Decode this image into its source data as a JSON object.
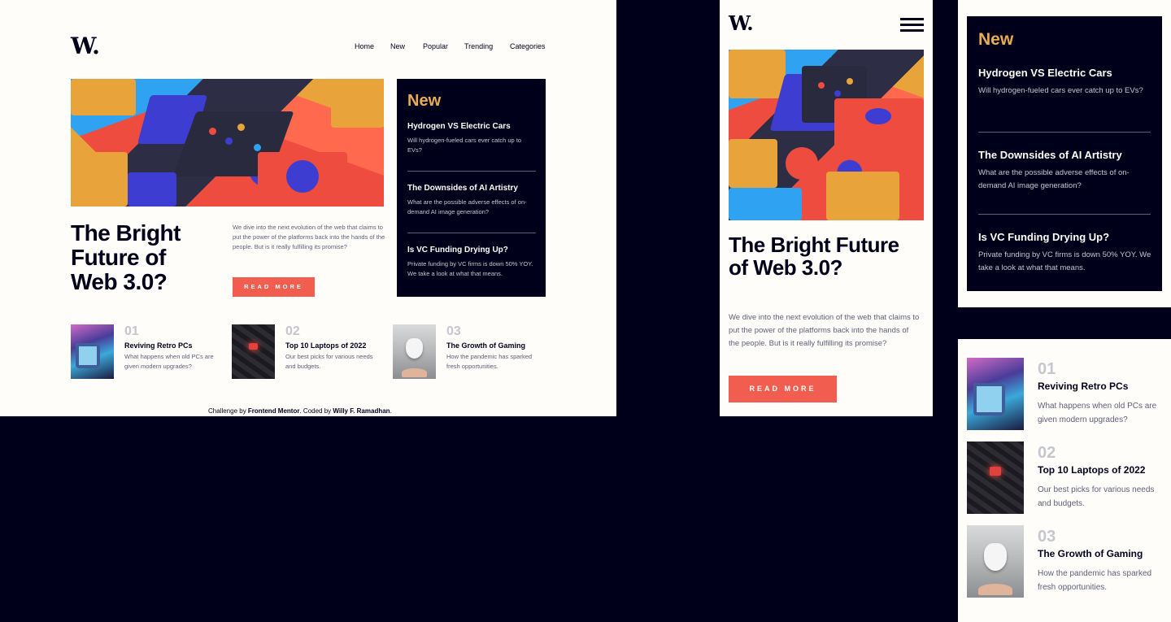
{
  "brand": {
    "logo": "W."
  },
  "nav": [
    "Home",
    "New",
    "Popular",
    "Trending",
    "Categories"
  ],
  "hero": {
    "title": "The Bright Future of Web 3.0?",
    "desc": "We dive into the next evolution of the web that claims to put the power of the platforms back into the hands of the people. But is it really fulfilling its promise?",
    "button": "READ MORE"
  },
  "new_section": {
    "heading": "New",
    "items": [
      {
        "title": "Hydrogen VS Electric Cars",
        "desc": "Will hydrogen-fueled cars ever catch up to EVs?"
      },
      {
        "title": "The Downsides of AI Artistry",
        "desc": "What are the possible adverse effects of on-demand AI image generation?"
      },
      {
        "title": "Is VC Funding Drying Up?",
        "desc": "Private funding by VC firms is down 50% YOY. We take a look at what that means."
      }
    ]
  },
  "articles": [
    {
      "num": "01",
      "title": "Reviving Retro PCs",
      "desc": "What happens when old PCs are given modern upgrades?"
    },
    {
      "num": "02",
      "title": "Top 10 Laptops of 2022",
      "desc": "Our best picks for various needs and budgets."
    },
    {
      "num": "03",
      "title": "The Growth of Gaming",
      "desc": "How the pandemic has sparked fresh opportunities."
    }
  ],
  "footer": {
    "prefix": "Challenge by ",
    "fm": "Frontend Mentor",
    "mid": ". Coded by ",
    "author": "Willy F. Ramadhan",
    "suffix": "."
  },
  "colors": {
    "bg": "#00001a",
    "panel": "#fffdfa",
    "accent": "#f15e50",
    "gold": "#e9ab53"
  }
}
